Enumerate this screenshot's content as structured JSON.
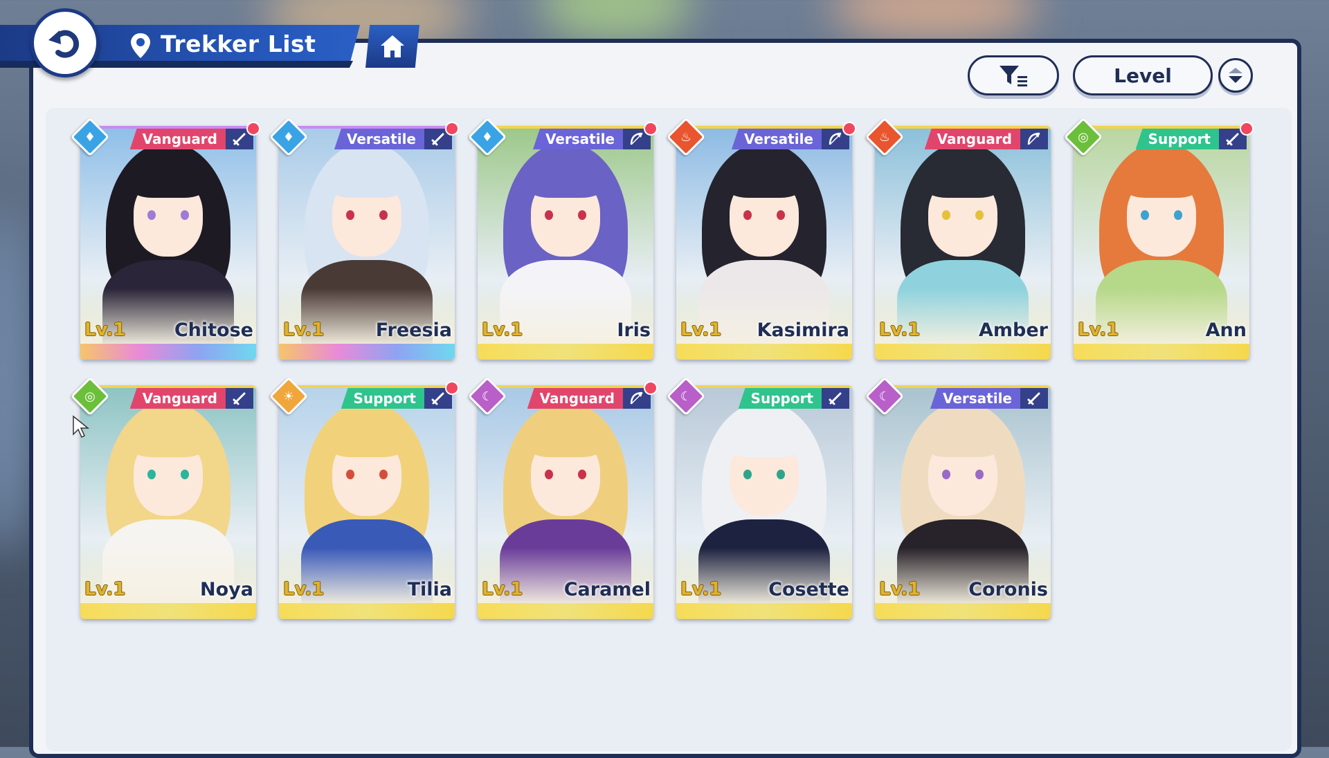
{
  "header": {
    "title": "Trekker List",
    "back_icon": "back-arrow-icon",
    "location_icon": "map-pin-icon",
    "home_icon": "home-icon"
  },
  "toolbar": {
    "filter_icon": "filter-icon",
    "sort_label": "Level",
    "order_icon": "sort-order-icon"
  },
  "colors": {
    "accent": "#1f2e55",
    "vanguard": "#e2456c",
    "versatile": "#6a64d8",
    "support": "#2fc48d",
    "new_badge": "#f0465f"
  },
  "trekkers": [
    {
      "name": "Chitose",
      "level": "Lv.1",
      "role": "Vanguard",
      "element": "water",
      "weapon_icon": "sword-icon",
      "new": true,
      "rarity": "rainbow"
    },
    {
      "name": "Freesia",
      "level": "Lv.1",
      "role": "Versatile",
      "element": "water",
      "weapon_icon": "sword-icon",
      "new": true,
      "rarity": "rainbow"
    },
    {
      "name": "Iris",
      "level": "Lv.1",
      "role": "Versatile",
      "element": "water",
      "weapon_icon": "bow-icon",
      "new": true,
      "rarity": "gold"
    },
    {
      "name": "Kasimira",
      "level": "Lv.1",
      "role": "Versatile",
      "element": "fire",
      "weapon_icon": "bow-icon",
      "new": true,
      "rarity": "gold"
    },
    {
      "name": "Amber",
      "level": "Lv.1",
      "role": "Vanguard",
      "element": "fire",
      "weapon_icon": "bow-icon",
      "new": false,
      "rarity": "gold"
    },
    {
      "name": "Ann",
      "level": "Lv.1",
      "role": "Support",
      "element": "wind",
      "weapon_icon": "sword-icon",
      "new": true,
      "rarity": "gold"
    },
    {
      "name": "Noya",
      "level": "Lv.1",
      "role": "Vanguard",
      "element": "wind",
      "weapon_icon": "sword-icon",
      "new": false,
      "rarity": "gold"
    },
    {
      "name": "Tilia",
      "level": "Lv.1",
      "role": "Support",
      "element": "light",
      "weapon_icon": "sword-icon",
      "new": true,
      "rarity": "gold"
    },
    {
      "name": "Caramel",
      "level": "Lv.1",
      "role": "Vanguard",
      "element": "dark",
      "weapon_icon": "bow-icon",
      "new": true,
      "rarity": "gold"
    },
    {
      "name": "Cosette",
      "level": "Lv.1",
      "role": "Support",
      "element": "dark",
      "weapon_icon": "sword-icon",
      "new": false,
      "rarity": "gold"
    },
    {
      "name": "Coronis",
      "level": "Lv.1",
      "role": "Versatile",
      "element": "dark",
      "weapon_icon": "sword-icon",
      "new": false,
      "rarity": "gold"
    }
  ]
}
